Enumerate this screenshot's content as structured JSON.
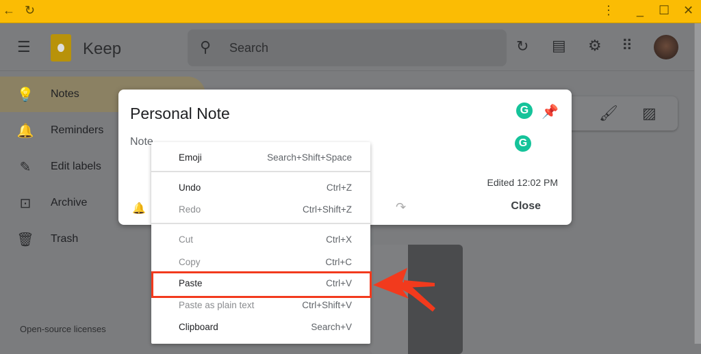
{
  "titlebar": {
    "back_icon": "arrow-left-icon",
    "reload_icon": "reload-icon",
    "more_icon": "more-vert-icon",
    "minimize_icon": "minimize-icon",
    "maximize_icon": "maximize-icon",
    "close_icon": "close-icon"
  },
  "header": {
    "brand": "Keep",
    "search_placeholder": "Search"
  },
  "sidebar": {
    "items": [
      {
        "label": "Notes",
        "icon": "lightbulb-icon",
        "active": true
      },
      {
        "label": "Reminders",
        "icon": "bell-icon"
      },
      {
        "label": "Edit labels",
        "icon": "pencil-icon"
      },
      {
        "label": "Archive",
        "icon": "archive-icon"
      },
      {
        "label": "Trash",
        "icon": "trash-icon"
      }
    ],
    "license": "Open-source licenses"
  },
  "dialog": {
    "title": "Personal Note",
    "body": "Note",
    "edited": "Edited 12:02 PM",
    "close": "Close"
  },
  "context_menu": {
    "items": [
      {
        "label": "Emoji",
        "shortcut": "Search+Shift+Space",
        "enabled": true
      },
      {
        "label": "Undo",
        "shortcut": "Ctrl+Z",
        "enabled": true
      },
      {
        "label": "Redo",
        "shortcut": "Ctrl+Shift+Z",
        "enabled": false
      },
      {
        "label": "Cut",
        "shortcut": "Ctrl+X",
        "enabled": false
      },
      {
        "label": "Copy",
        "shortcut": "Ctrl+C",
        "enabled": false
      },
      {
        "label": "Paste",
        "shortcut": "Ctrl+V",
        "enabled": true,
        "highlighted": true
      },
      {
        "label": "Paste as plain text",
        "shortcut": "Ctrl+Shift+V",
        "enabled": false
      },
      {
        "label": "Clipboard",
        "shortcut": "Search+V",
        "enabled": true
      }
    ]
  },
  "colors": {
    "titlebar": "#fbbc04",
    "annotation": "#f23a1d",
    "grammarly": "#15c39a"
  }
}
